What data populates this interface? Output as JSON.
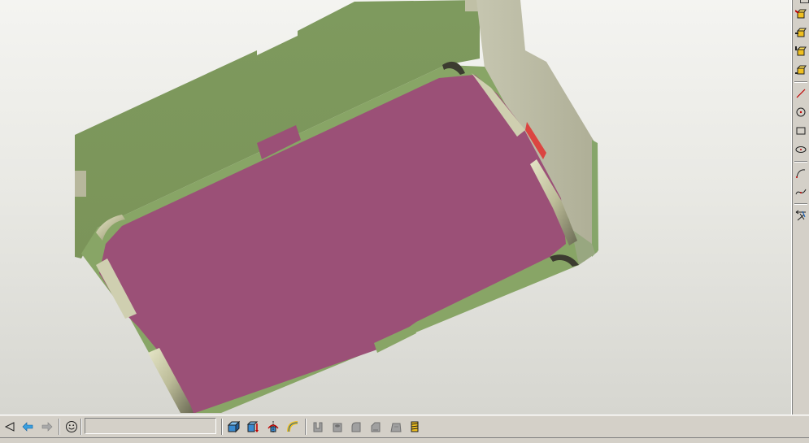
{
  "viewport": {
    "part": "pocket-block",
    "colors": {
      "background_top": "#f4f4f1",
      "background_bottom": "#d6d6d0",
      "outer_wall": "#7a9259",
      "rim": "#88a566",
      "pocket_floor": "#9b5077",
      "fillet": "#c8c8a4",
      "end_face": "#b9b9a0",
      "highlight_edge": "#e03030"
    }
  },
  "right_toolbar": {
    "icons": [
      "front-view-icon",
      "back-view-icon",
      "top-view-icon",
      "bottom-view-icon",
      "line-icon",
      "circle-icon",
      "rectangle-icon",
      "ellipse-icon",
      "arc-icon",
      "spline-icon",
      "dimension-icon"
    ]
  },
  "bottom_toolbar": {
    "message": "",
    "icons": [
      "back-triangle-icon",
      "previous-arrow-icon",
      "next-arrow-icon",
      "smiley-icon",
      "shaded-box-icon",
      "extrude-icon",
      "revolve-icon",
      "sweep-icon",
      "pocket-icon",
      "hole-icon",
      "fillet-icon",
      "chamfer-icon",
      "draft-icon",
      "thread-icon"
    ]
  }
}
